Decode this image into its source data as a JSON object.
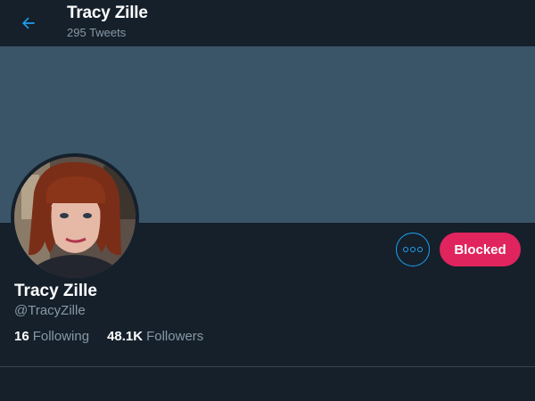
{
  "header": {
    "back_icon": "arrow-left-icon",
    "title": "Tracy Zille",
    "subtitle": "295 Tweets"
  },
  "profile": {
    "name": "Tracy Zille",
    "handle": "@TracyZille",
    "banner_color": "#3a5568",
    "following_count": "16",
    "following_label": "Following",
    "followers_count": "48.1K",
    "followers_label": "Followers"
  },
  "actions": {
    "more_icon": "more-horizontal-icon",
    "blocked_label": "Blocked",
    "accent_color": "#1da1f2",
    "blocked_color": "#e0245e"
  }
}
